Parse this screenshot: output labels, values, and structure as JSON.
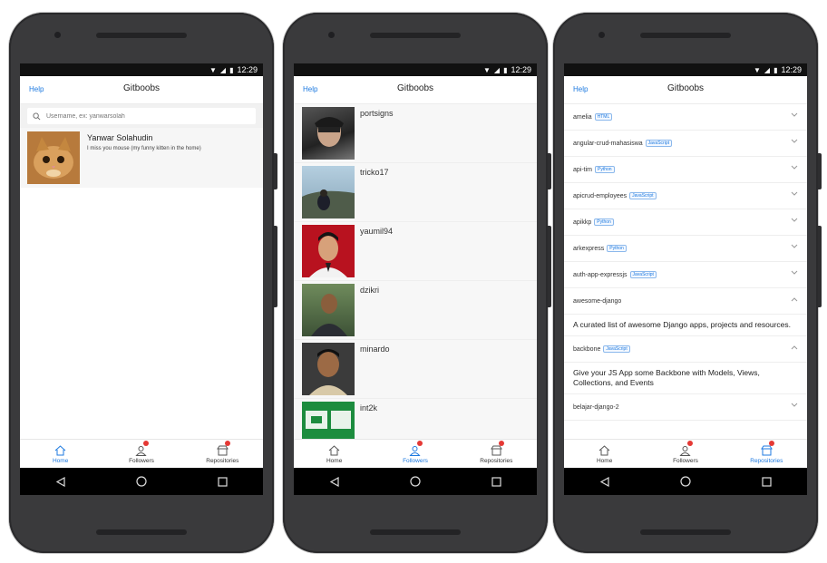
{
  "status": {
    "time": "12:29"
  },
  "app": {
    "title": "Gitboobs",
    "help": "Help"
  },
  "tabs": [
    {
      "label": "Home"
    },
    {
      "label": "Followers"
    },
    {
      "label": "Repositories"
    }
  ],
  "home": {
    "search_placeholder": "Username, ex: yanwarsolah",
    "user": {
      "name": "Yanwar Solahudin",
      "bio": "I miss you mouse (my funny kitten in the home)"
    }
  },
  "followers": [
    {
      "login": "portsigns"
    },
    {
      "login": "tricko17"
    },
    {
      "login": "yaumil94"
    },
    {
      "login": "dzikri"
    },
    {
      "login": "minardo"
    },
    {
      "login": "int2k"
    }
  ],
  "repos": [
    {
      "name": "amelia",
      "lang": "HTML"
    },
    {
      "name": "angular-crud-mahasiswa",
      "lang": "JavaScript"
    },
    {
      "name": "api-tim",
      "lang": "Python"
    },
    {
      "name": "apicrud-employees",
      "lang": "JavaScript"
    },
    {
      "name": "apikkp",
      "lang": "Python"
    },
    {
      "name": "arkexpress",
      "lang": "Python"
    },
    {
      "name": "auth-app-expressjs",
      "lang": "JavaScript"
    },
    {
      "name": "awesome-django",
      "lang": "",
      "expanded": true,
      "description": "A curated list of awesome Django apps, projects and resources."
    },
    {
      "name": "backbone",
      "lang": "JavaScript",
      "expanded": true,
      "description": "Give your JS App some Backbone with Models, Views, Collections, and Events"
    },
    {
      "name": "belajar-django-2",
      "lang": ""
    }
  ],
  "colors": {
    "accent": "#1e7ae0",
    "badge": "#e53935"
  }
}
